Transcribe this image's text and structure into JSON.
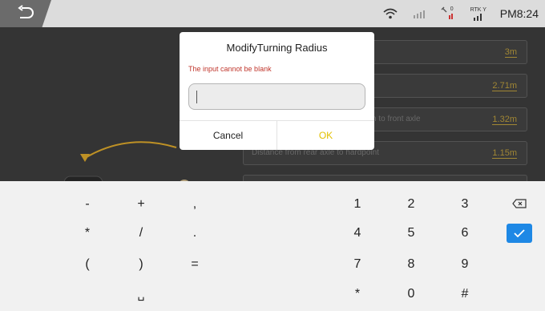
{
  "status": {
    "time": "PM8:24",
    "rtk_label": "RTK",
    "rtk_sub": "Y",
    "sat_count": "0"
  },
  "params": [
    {
      "label": "",
      "value": "3m"
    },
    {
      "label": "",
      "value": "2.71m"
    },
    {
      "label": "n to front axle",
      "value": "1.32m"
    },
    {
      "label": "Distance from rear axle to hardpoint",
      "value": "1.15m"
    }
  ],
  "dialog": {
    "title": "ModifyTurning Radius",
    "error": "The input cannot be blank",
    "input_value": "",
    "cancel_label": "Cancel",
    "ok_label": "OK"
  },
  "keyboard": {
    "row1": [
      "-",
      "+",
      ",",
      "1",
      "2",
      "3"
    ],
    "row2": [
      "*",
      "/",
      ".",
      "4",
      "5",
      "6"
    ],
    "row3": [
      "(",
      ")",
      "=",
      "7",
      "8",
      "9"
    ],
    "row4": [
      "␣",
      "*",
      "0",
      "#"
    ]
  },
  "colors": {
    "accent_ok": "#e3c000",
    "error": "#c0362c",
    "value": "#b89a3c",
    "enter": "#1e88e5"
  }
}
